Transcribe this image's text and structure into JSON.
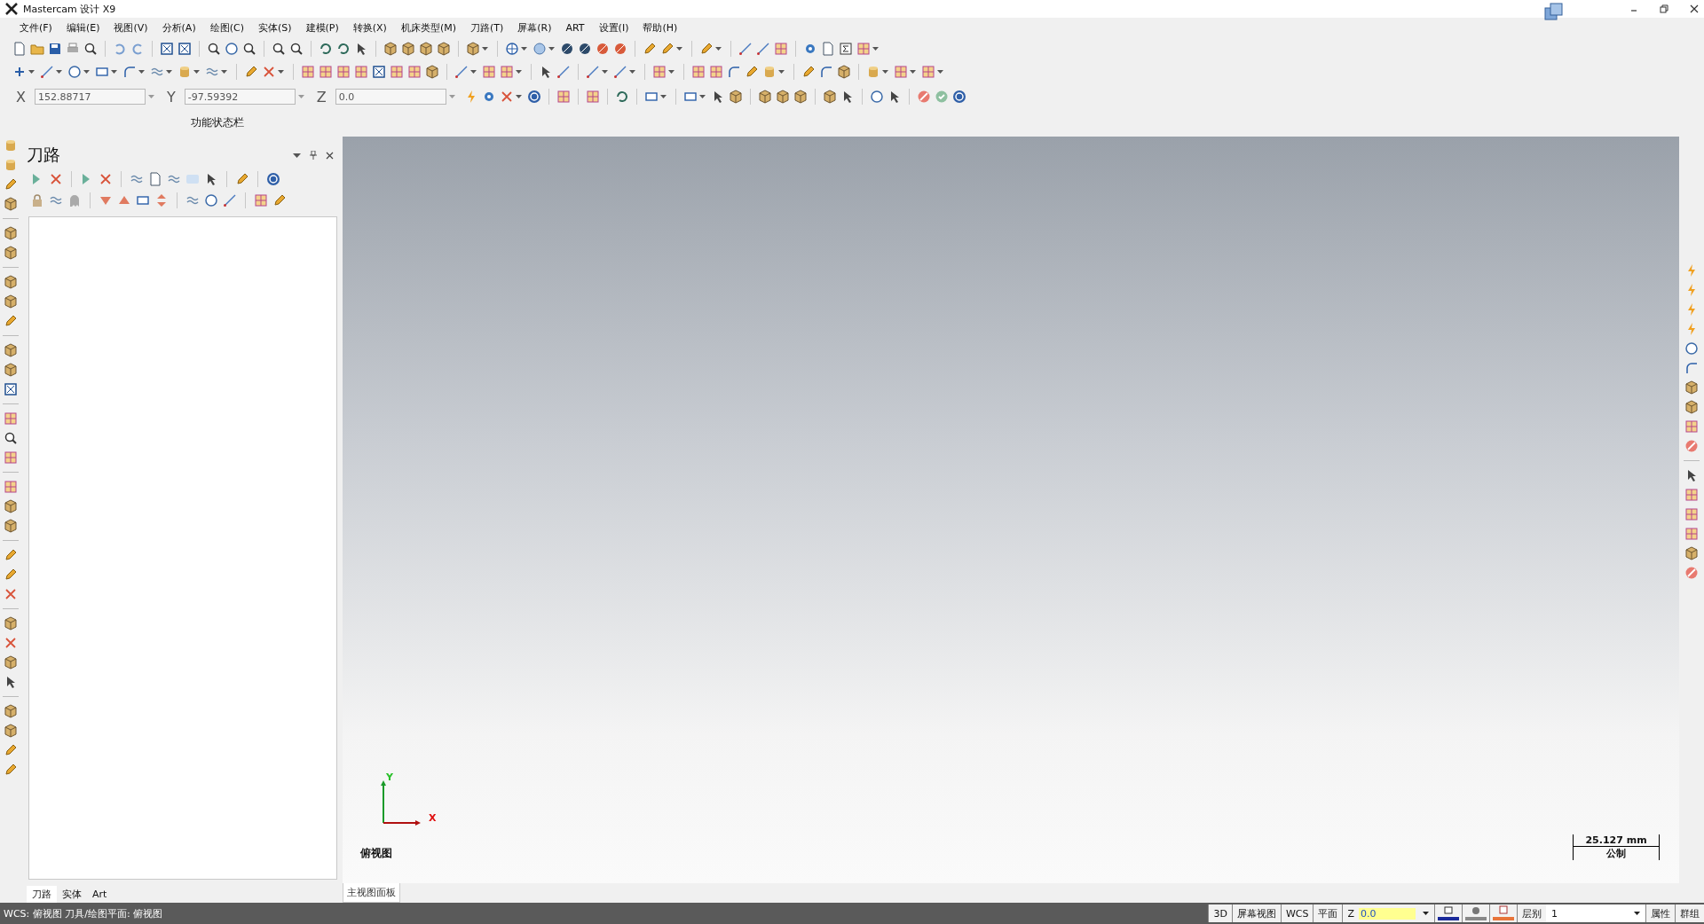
{
  "window": {
    "title": "Mastercam 设计 X9"
  },
  "menu": [
    {
      "label": "文件(F)"
    },
    {
      "label": "编辑(E)"
    },
    {
      "label": "视图(V)"
    },
    {
      "label": "分析(A)"
    },
    {
      "label": "绘图(C)"
    },
    {
      "label": "实体(S)"
    },
    {
      "label": "建模(P)"
    },
    {
      "label": "转换(X)"
    },
    {
      "label": "机床类型(M)"
    },
    {
      "label": "刀路(T)"
    },
    {
      "label": "屏幕(R)"
    },
    {
      "label": "ART"
    },
    {
      "label": "设置(I)"
    },
    {
      "label": "帮助(H)"
    }
  ],
  "coordinates": [
    {
      "axis": "X",
      "value": "152.88717"
    },
    {
      "axis": "Y",
      "value": "-97.59392"
    },
    {
      "axis": "Z",
      "value": "0.0"
    }
  ],
  "function_bar": {
    "title": "功能状态栏"
  },
  "toolpath_panel": {
    "title": "刀路"
  },
  "viewport": {
    "view_name": "俯视图",
    "axis_x": "X",
    "axis_y": "Y",
    "scale": "25.127 mm",
    "units": "公制"
  },
  "panel_tabs": [
    {
      "label": "刀路",
      "selected": true
    },
    {
      "label": "实体",
      "selected": false
    },
    {
      "label": "Art",
      "selected": false
    }
  ],
  "viewport_tabs": [
    {
      "label": "主视图面板",
      "selected": true
    }
  ],
  "status_bar": {
    "info": "WCS: 俯视图 刀具/绘图平面: 俯视图",
    "items": [
      {
        "kind": "button",
        "label": "3D"
      },
      {
        "kind": "button",
        "label": "屏幕视图"
      },
      {
        "kind": "button",
        "label": "WCS"
      },
      {
        "kind": "button",
        "label": "平面"
      },
      {
        "kind": "field",
        "label": "Z",
        "value": "0.0"
      },
      {
        "kind": "dropdown",
        "label": "层别",
        "value": "1"
      },
      {
        "kind": "button",
        "label": "属性"
      },
      {
        "kind": "button",
        "label": "群组"
      }
    ]
  }
}
